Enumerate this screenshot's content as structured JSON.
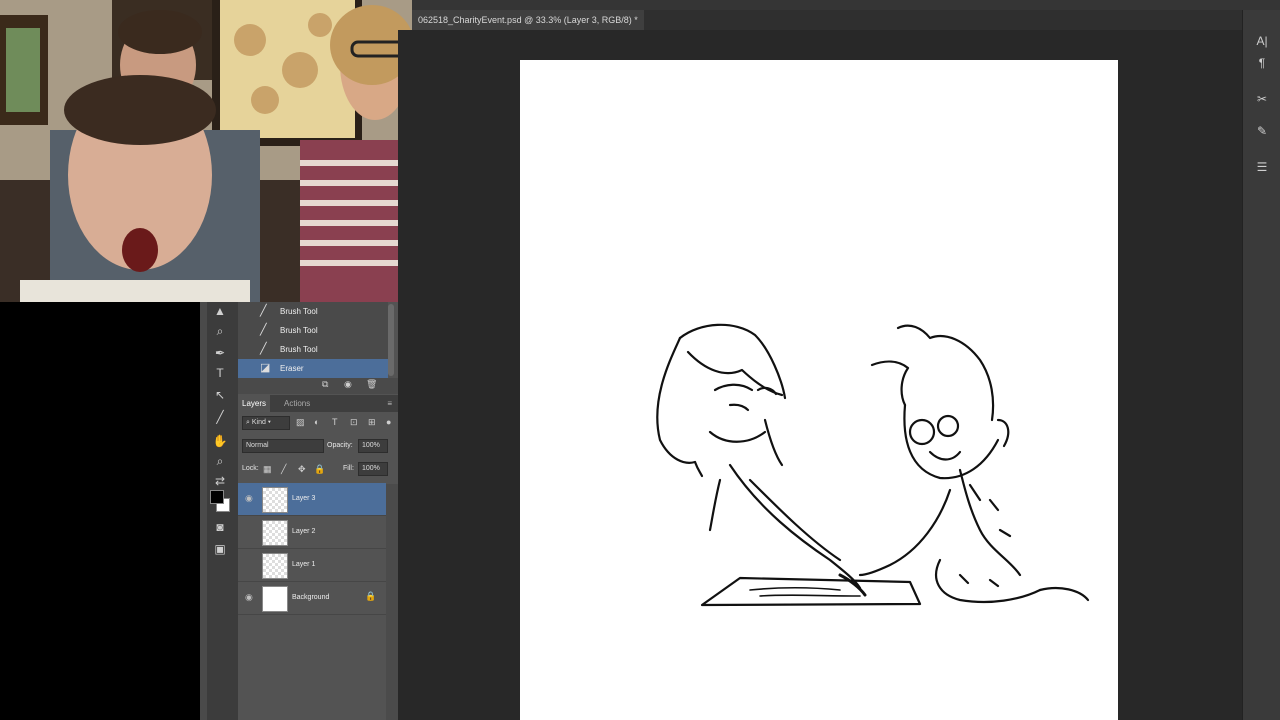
{
  "document": {
    "tab_title": "062518_CharityEvent.psd @ 33.3% (Layer 3, RGB/8) *"
  },
  "history": {
    "items": [
      {
        "label": "Brush Tool",
        "icon": "brush-icon",
        "selected": false
      },
      {
        "label": "Brush Tool",
        "icon": "brush-icon",
        "selected": false
      },
      {
        "label": "Brush Tool",
        "icon": "brush-icon",
        "selected": false
      },
      {
        "label": "Eraser",
        "icon": "eraser-icon",
        "selected": true
      }
    ]
  },
  "layers_panel": {
    "tabs": [
      "Layers",
      "Actions"
    ],
    "filter_kind": "Kind",
    "blend_mode": "Normal",
    "opacity_label": "Opacity:",
    "opacity_value": "100%",
    "lock_label": "Lock:",
    "fill_label": "Fill:",
    "fill_value": "100%",
    "layers": [
      {
        "name": "Layer 3",
        "visible": true,
        "selected": true,
        "locked": false
      },
      {
        "name": "Layer 2",
        "visible": false,
        "selected": false,
        "locked": false
      },
      {
        "name": "Layer 1",
        "visible": false,
        "selected": false,
        "locked": false
      },
      {
        "name": "Background",
        "visible": true,
        "selected": false,
        "locked": true
      }
    ]
  },
  "colors": {
    "foreground": "#000000",
    "background": "#ffffff",
    "selection": "#4c6e9a",
    "panel": "#535353"
  },
  "right_toolbar": {
    "icons": [
      "character-icon",
      "paragraph-icon",
      "tools-icon",
      "brush-presets-icon",
      "adjustments-icon"
    ]
  }
}
